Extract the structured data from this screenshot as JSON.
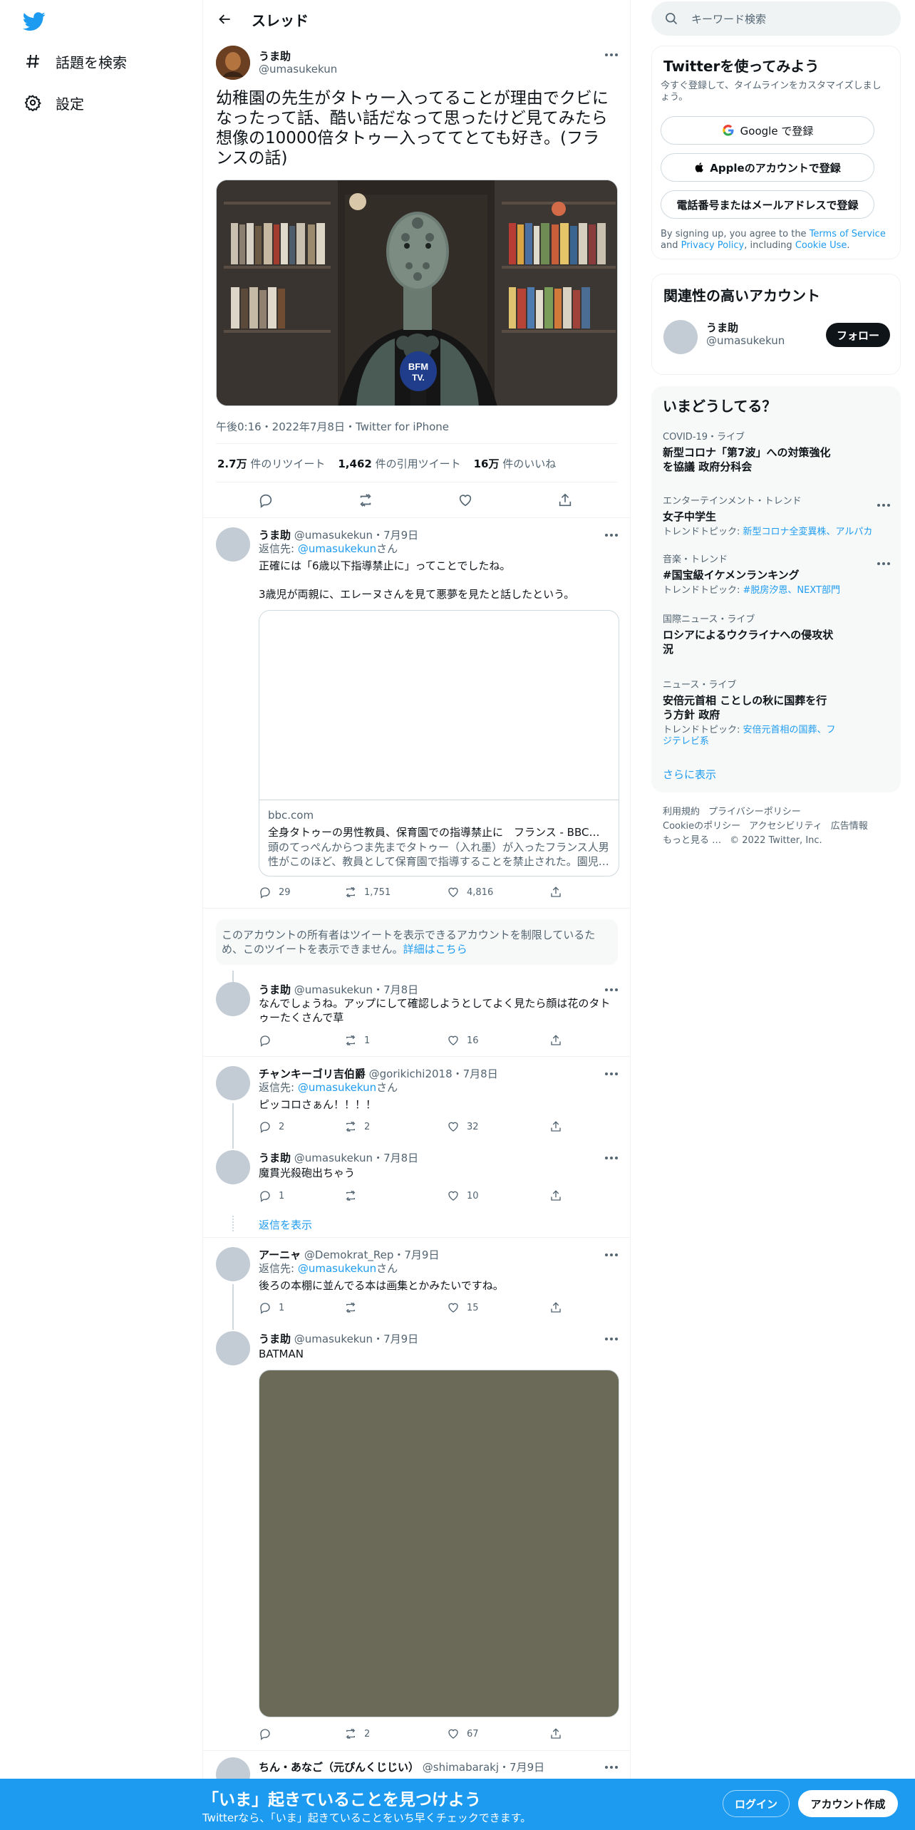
{
  "nav": {
    "logo": "twitter-bird-icon",
    "items": [
      {
        "label": "話題を検索",
        "icon": "hashtag-icon"
      },
      {
        "label": "設定",
        "icon": "gear-icon"
      }
    ]
  },
  "header": {
    "title": "スレッド"
  },
  "main_tweet": {
    "name": "うま助",
    "handle": "@umasukekun",
    "text": "幼稚園の先生がタトゥー入ってることが理由でクビになったって話、酷い話だなって思ったけど見てみたら想像の10000倍タトゥー入っててとても好き。(フランスの話)",
    "mic_label": "BFM TV.",
    "meta": "午後0:16・2022年7月8日・Twitter for iPhone",
    "retweets_count": "2.7万",
    "retweets_label": "件のリツイート",
    "quotes_count": "1,462",
    "quotes_label": "件の引用ツイート",
    "likes_count": "16万",
    "likes_label": "件のいいね"
  },
  "replies": [
    {
      "name": "うま助",
      "handle": "@umasukekun",
      "date": "・7月9日",
      "reply_to_prefix": "返信先: ",
      "reply_to": "@umasukekun",
      "reply_to_suffix": "さん",
      "text1": "正確には「6歳以下指導禁止に」ってことでしたね。",
      "text2": "3歳児が両親に、エレーヌさんを見て悪夢を見たと話したという。",
      "card": {
        "domain": "bbc.com",
        "title": "全身タトゥーの男性教員、保育園での指導禁止に　フランス - BBCニュース",
        "desc": "頭のてっぺんからつま先までタトゥー（入れ墨）が入ったフランス人男性がこのほど、教員として保育園で指導することを禁止された。園児…"
      },
      "replies": "29",
      "retweets": "1,751",
      "likes": "4,816"
    },
    {
      "notice": "このアカウントの所有者はツイートを表示できるアカウントを制限しているため、このツイートを表示できません。",
      "notice_link": "詳細はこちら"
    },
    {
      "name": "うま助",
      "handle": "@umasukekun",
      "date": "・7月8日",
      "text": "なんでしょうね。アップにして確認しようとしてよく見たら顔は花のタトゥーたくさんで草",
      "replies": "",
      "retweets": "1",
      "likes": "16"
    },
    {
      "name": "チャンキーゴリ吉伯爵",
      "handle": "@gorikichi2018",
      "date": "・7月8日",
      "reply_to_prefix": "返信先: ",
      "reply_to": "@umasukekun",
      "reply_to_suffix": "さん",
      "text": "ピッコロさぁん！！！！",
      "replies": "2",
      "retweets": "2",
      "likes": "32"
    },
    {
      "name": "うま助",
      "handle": "@umasukekun",
      "date": "・7月8日",
      "text": "魔貫光殺砲出ちゃう",
      "replies": "1",
      "retweets": "",
      "likes": "10"
    },
    {
      "show_replies": "返信を表示"
    },
    {
      "name": "アーニャ",
      "handle": "@Demokrat_Rep",
      "date": "・7月9日",
      "reply_to_prefix": "返信先: ",
      "reply_to": "@umasukekun",
      "reply_to_suffix": "さん",
      "text": "後ろの本棚に並んでる本は画集とかみたいですね。",
      "replies": "1",
      "retweets": "",
      "likes": "15"
    },
    {
      "name": "うま助",
      "handle": "@umasukekun",
      "date": "・7月9日",
      "text": "BATMAN",
      "replies": "",
      "retweets": "2",
      "likes": "67"
    },
    {
      "name": "ちん・あなご（元ぴんくじじい）",
      "handle": "@shimabarakj",
      "date": "・7月9日"
    }
  ],
  "right": {
    "search_placeholder": "キーワード検索",
    "signup": {
      "title": "Twitterを使ってみよう",
      "desc": "今すぐ登録して、タイムラインをカスタマイズしましょう。",
      "google": "Google で登録",
      "apple": "Appleのアカウントで登録",
      "phone": "電話番号またはメールアドレスで登録",
      "legal_1": "By signing up, you agree to the ",
      "terms": "Terms of Service",
      "legal_2": " and ",
      "privacy": "Privacy Policy",
      "legal_3": ", including ",
      "cookie": "Cookie Use",
      "legal_4": "."
    },
    "relevant": {
      "title": "関連性の高いアカウント",
      "name": "うま助",
      "handle": "@umasukekun",
      "follow": "フォロー"
    },
    "trends": {
      "title": "いまどうしてる？",
      "items": [
        {
          "category": "COVID-19・ライブ",
          "title": "新型コロナ「第7波」への対策強化を協議 政府分科会"
        },
        {
          "category": "エンターテインメント・トレンド",
          "title": "女子中学生",
          "sub_prefix": "トレンドトピック: ",
          "sub_links": "新型コロナ全変異株、アルパカ"
        },
        {
          "category": "音楽・トレンド",
          "title": "#国宝級イケメンランキング",
          "sub_prefix": "トレンドトピック: ",
          "sub_links": "#脱房汐恩、NEXT部門"
        },
        {
          "category": "国際ニュース・ライブ",
          "title": "ロシアによるウクライナへの侵攻状況"
        },
        {
          "category": "ニュース・ライブ",
          "title": "安倍元首相 ことしの秋に国葬を行う方針 政府",
          "sub_prefix": "トレンドトピック: ",
          "sub_links": "安倍元首相の国葬、フジテレビ系"
        }
      ],
      "show_more": "さらに表示"
    },
    "footer": {
      "terms": "利用規約",
      "privacy": "プライバシーポリシー",
      "cookie": "Cookieのポリシー",
      "accessibility": "アクセシビリティ",
      "ads": "広告情報",
      "more": "もっと見る …",
      "copyright": "© 2022 Twitter, Inc."
    }
  },
  "bottom_bar": {
    "title": "「いま」起きていることを見つけよう",
    "subtitle": "Twitterなら、「いま」起きていることをいち早くチェックできます。",
    "login": "ログイン",
    "signup": "アカウント作成"
  },
  "colors": {
    "accent": "#1d9bf0",
    "text": "#0f1419",
    "muted": "#536471"
  }
}
